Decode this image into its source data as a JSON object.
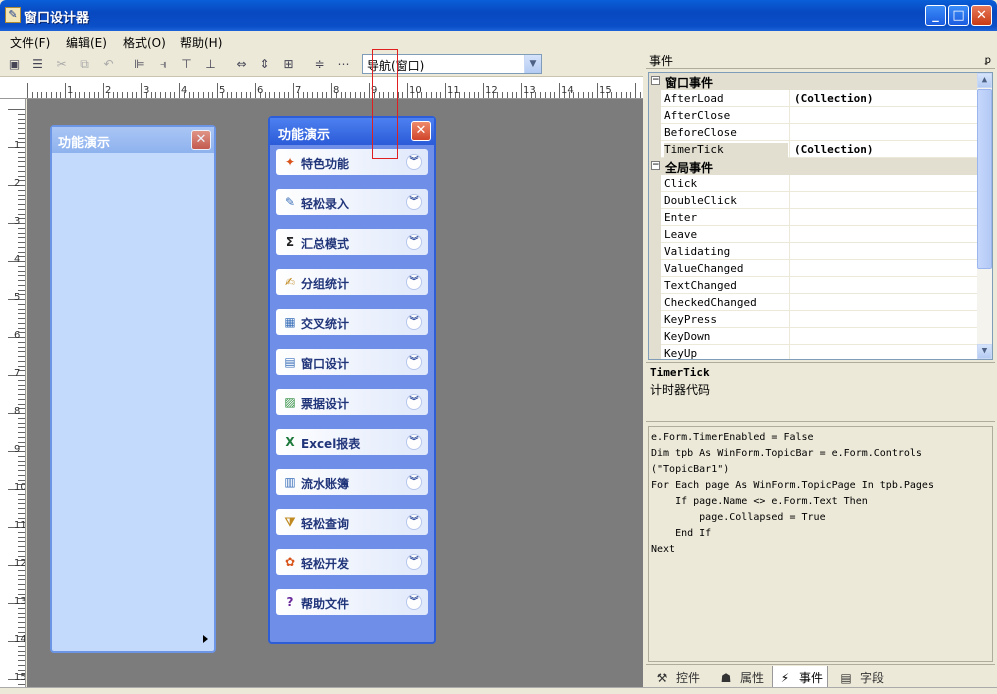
{
  "window": {
    "title": "窗口设计器",
    "icon": "designer-icon",
    "min_label": "_",
    "max_label": "□",
    "close_label": "✕"
  },
  "menu": {
    "items": [
      "文件(F)",
      "编辑(E)",
      "格式(O)",
      "帮助(H)"
    ]
  },
  "toolbar": {
    "buttons": [
      {
        "name": "save-icon",
        "glyph": "▣"
      },
      {
        "name": "properties-icon",
        "glyph": "☰"
      },
      {
        "name": "cut-icon",
        "glyph": "✂",
        "disabled": true
      },
      {
        "name": "copy-icon",
        "glyph": "⧉",
        "disabled": true
      },
      {
        "name": "undo-icon",
        "glyph": "↶",
        "disabled": true
      },
      {
        "name": "align-left-icon",
        "glyph": "⊫"
      },
      {
        "name": "align-right-icon",
        "glyph": "⫣"
      },
      {
        "name": "align-top-icon",
        "glyph": "⊤"
      },
      {
        "name": "align-bottom-icon",
        "glyph": "⊥"
      },
      {
        "name": "same-width-icon",
        "glyph": "⇔"
      },
      {
        "name": "same-height-icon",
        "glyph": "⇕"
      },
      {
        "name": "same-size-icon",
        "glyph": "⊞"
      },
      {
        "name": "vertical-spacing-icon",
        "glyph": "≑"
      },
      {
        "name": "horizontal-spacing-icon",
        "glyph": "⋯"
      }
    ],
    "nav_combo": "导航(窗口)"
  },
  "ruler": {
    "h": [
      "1",
      "2",
      "3",
      "4",
      "5",
      "6",
      "7",
      "8",
      "9",
      "10",
      "11",
      "12",
      "13",
      "14",
      "15"
    ],
    "v": [
      "1",
      "2",
      "3",
      "4",
      "5",
      "6",
      "7",
      "8",
      "9",
      "10",
      "11",
      "12",
      "13",
      "14",
      "15"
    ]
  },
  "left_pane": {
    "title": "功能演示",
    "close_label": "✕"
  },
  "right_pane": {
    "title": "功能演示",
    "close_label": "✕",
    "chevron": "︾",
    "groups": [
      {
        "label": "特色功能",
        "icon": "star-feature-icon",
        "glyph": "✦",
        "color": "#d8541a"
      },
      {
        "label": "轻松录入",
        "icon": "edit-form-icon",
        "glyph": "✎",
        "color": "#3a6fb8"
      },
      {
        "label": "汇总模式",
        "icon": "sum-icon",
        "glyph": "Σ",
        "color": "#222"
      },
      {
        "label": "分组统计",
        "icon": "group-stat-icon",
        "glyph": "✍",
        "color": "#c08a20"
      },
      {
        "label": "交叉统计",
        "icon": "cross-table-icon",
        "glyph": "▦",
        "color": "#3a6fb8"
      },
      {
        "label": "窗口设计",
        "icon": "window-design-icon",
        "glyph": "▤",
        "color": "#3a6fb8"
      },
      {
        "label": "票据设计",
        "icon": "bill-design-icon",
        "glyph": "▨",
        "color": "#2a8a3a"
      },
      {
        "label": "Excel报表",
        "icon": "excel-icon",
        "glyph": "X",
        "color": "#1d7a3a"
      },
      {
        "label": "流水账簿",
        "icon": "ledger-icon",
        "glyph": "▥",
        "color": "#3a6fb8"
      },
      {
        "label": "轻松查询",
        "icon": "query-filter-icon",
        "glyph": "⧩",
        "color": "#c08a20"
      },
      {
        "label": "轻松开发",
        "icon": "develop-icon",
        "glyph": "✿",
        "color": "#d8541a"
      },
      {
        "label": "帮助文件",
        "icon": "help-icon",
        "glyph": "?",
        "color": "#6a2a9a"
      }
    ]
  },
  "events_panel": {
    "title": "事件",
    "pin": "ꝑ",
    "categories": [
      {
        "label": "窗口事件",
        "toggle": "−",
        "rows": [
          {
            "name": "AfterLoad",
            "value": "(Collection)"
          },
          {
            "name": "AfterClose",
            "value": ""
          },
          {
            "name": "BeforeClose",
            "value": ""
          },
          {
            "name": "TimerTick",
            "value": "(Collection)",
            "selected": true
          }
        ]
      },
      {
        "label": "全局事件",
        "toggle": "−",
        "rows": [
          {
            "name": "Click",
            "value": ""
          },
          {
            "name": "DoubleClick",
            "value": ""
          },
          {
            "name": "Enter",
            "value": ""
          },
          {
            "name": "Leave",
            "value": ""
          },
          {
            "name": "Validating",
            "value": ""
          },
          {
            "name": "ValueChanged",
            "value": ""
          },
          {
            "name": "TextChanged",
            "value": ""
          },
          {
            "name": "CheckedChanged",
            "value": ""
          },
          {
            "name": "KeyPress",
            "value": ""
          },
          {
            "name": "KeyDown",
            "value": ""
          },
          {
            "name": "KeyUp",
            "value": ""
          }
        ]
      }
    ],
    "description": {
      "name": "TimerTick",
      "text": "计时器代码"
    },
    "code": "e.Form.TimerEnabled = False\nDim tpb As WinForm.TopicBar = e.Form.Controls\n(\"TopicBar1\")\nFor Each page As WinForm.TopicPage In tpb.Pages\n    If page.Name <> e.Form.Text Then\n        page.Collapsed = True\n    End If\nNext",
    "tabs": [
      {
        "label": "控件",
        "icon": "tools-icon",
        "glyph": "⚒"
      },
      {
        "label": "属性",
        "icon": "properties-tab-icon",
        "glyph": "☗"
      },
      {
        "label": "事件",
        "icon": "lightning-icon",
        "glyph": "⚡",
        "active": true
      },
      {
        "label": "字段",
        "icon": "field-icon",
        "glyph": "▤"
      }
    ]
  }
}
